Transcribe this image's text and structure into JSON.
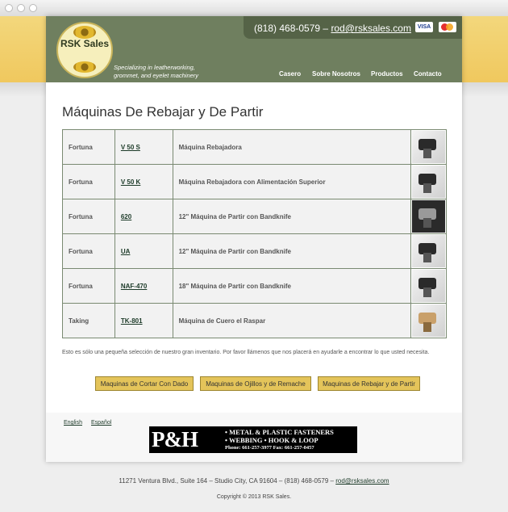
{
  "header": {
    "logo_text": "RSK Sales",
    "tagline_line1": "Specializing in leatherworking,",
    "tagline_line2": "grommet, and eyelet machinery",
    "phone": "(818) 468-0579",
    "separator": "–",
    "email": "rod@rsksales.com",
    "card_visa": "VISA",
    "card_mc": "MasterCard"
  },
  "nav": {
    "items": [
      "Casero",
      "Sobre Nosotros",
      "Productos",
      "Contacto"
    ]
  },
  "main": {
    "title": "Máquinas De Rebajar y De Partir",
    "table": [
      {
        "brand": "Fortuna",
        "model": "V 50 S",
        "description": "Máquina Rebajadora"
      },
      {
        "brand": "Fortuna",
        "model": "V 50 K",
        "description": "Máquina Rebajadora con Alimentación Superior"
      },
      {
        "brand": "Fortuna",
        "model": "620",
        "description": "12\" Máquina de Partir con Bandknife"
      },
      {
        "brand": "Fortuna",
        "model": "UA",
        "description": "12\" Máquina de Partir con Bandknife"
      },
      {
        "brand": "Fortuna",
        "model": "NAF-470",
        "description": "18\" Máquina de Partir con Bandknife"
      },
      {
        "brand": "Taking",
        "model": "TK-801",
        "description": "Máquina de Cuero el Raspar"
      }
    ],
    "note": "Esto es sólo una pequeña selección de nuestro gran inventario. Por favor llámenos que nos placerá en ayudarle a encontrar lo que usted necesita.",
    "buttons": [
      "Maquinas de Cortar Con Dado",
      "Maquinas de Ojillos y de Remache",
      "Maquinas de Rebajar y de Partir"
    ]
  },
  "footer": {
    "lang_english": "English",
    "lang_spanish": "Español",
    "ad_logo": "P&H",
    "ad_line1": "• METAL & PLASTIC FASTENERS",
    "ad_line2": "• WEBBING • HOOK & LOOP",
    "ad_line3": "Phone: 661-257-3977 Fax: 661-257-0457",
    "address": "11271 Ventura Blvd., Suite 164  –  Studio City, CA 91604  –  (818) 468-0579  –",
    "address_email": "rod@rsksales.com",
    "copyright": "Copyright © 2013 RSK Sales."
  },
  "colors": {
    "header_green": "#6f7f5f",
    "band_yellow": "#f0c85e",
    "button_gold": "#e4c45a"
  }
}
